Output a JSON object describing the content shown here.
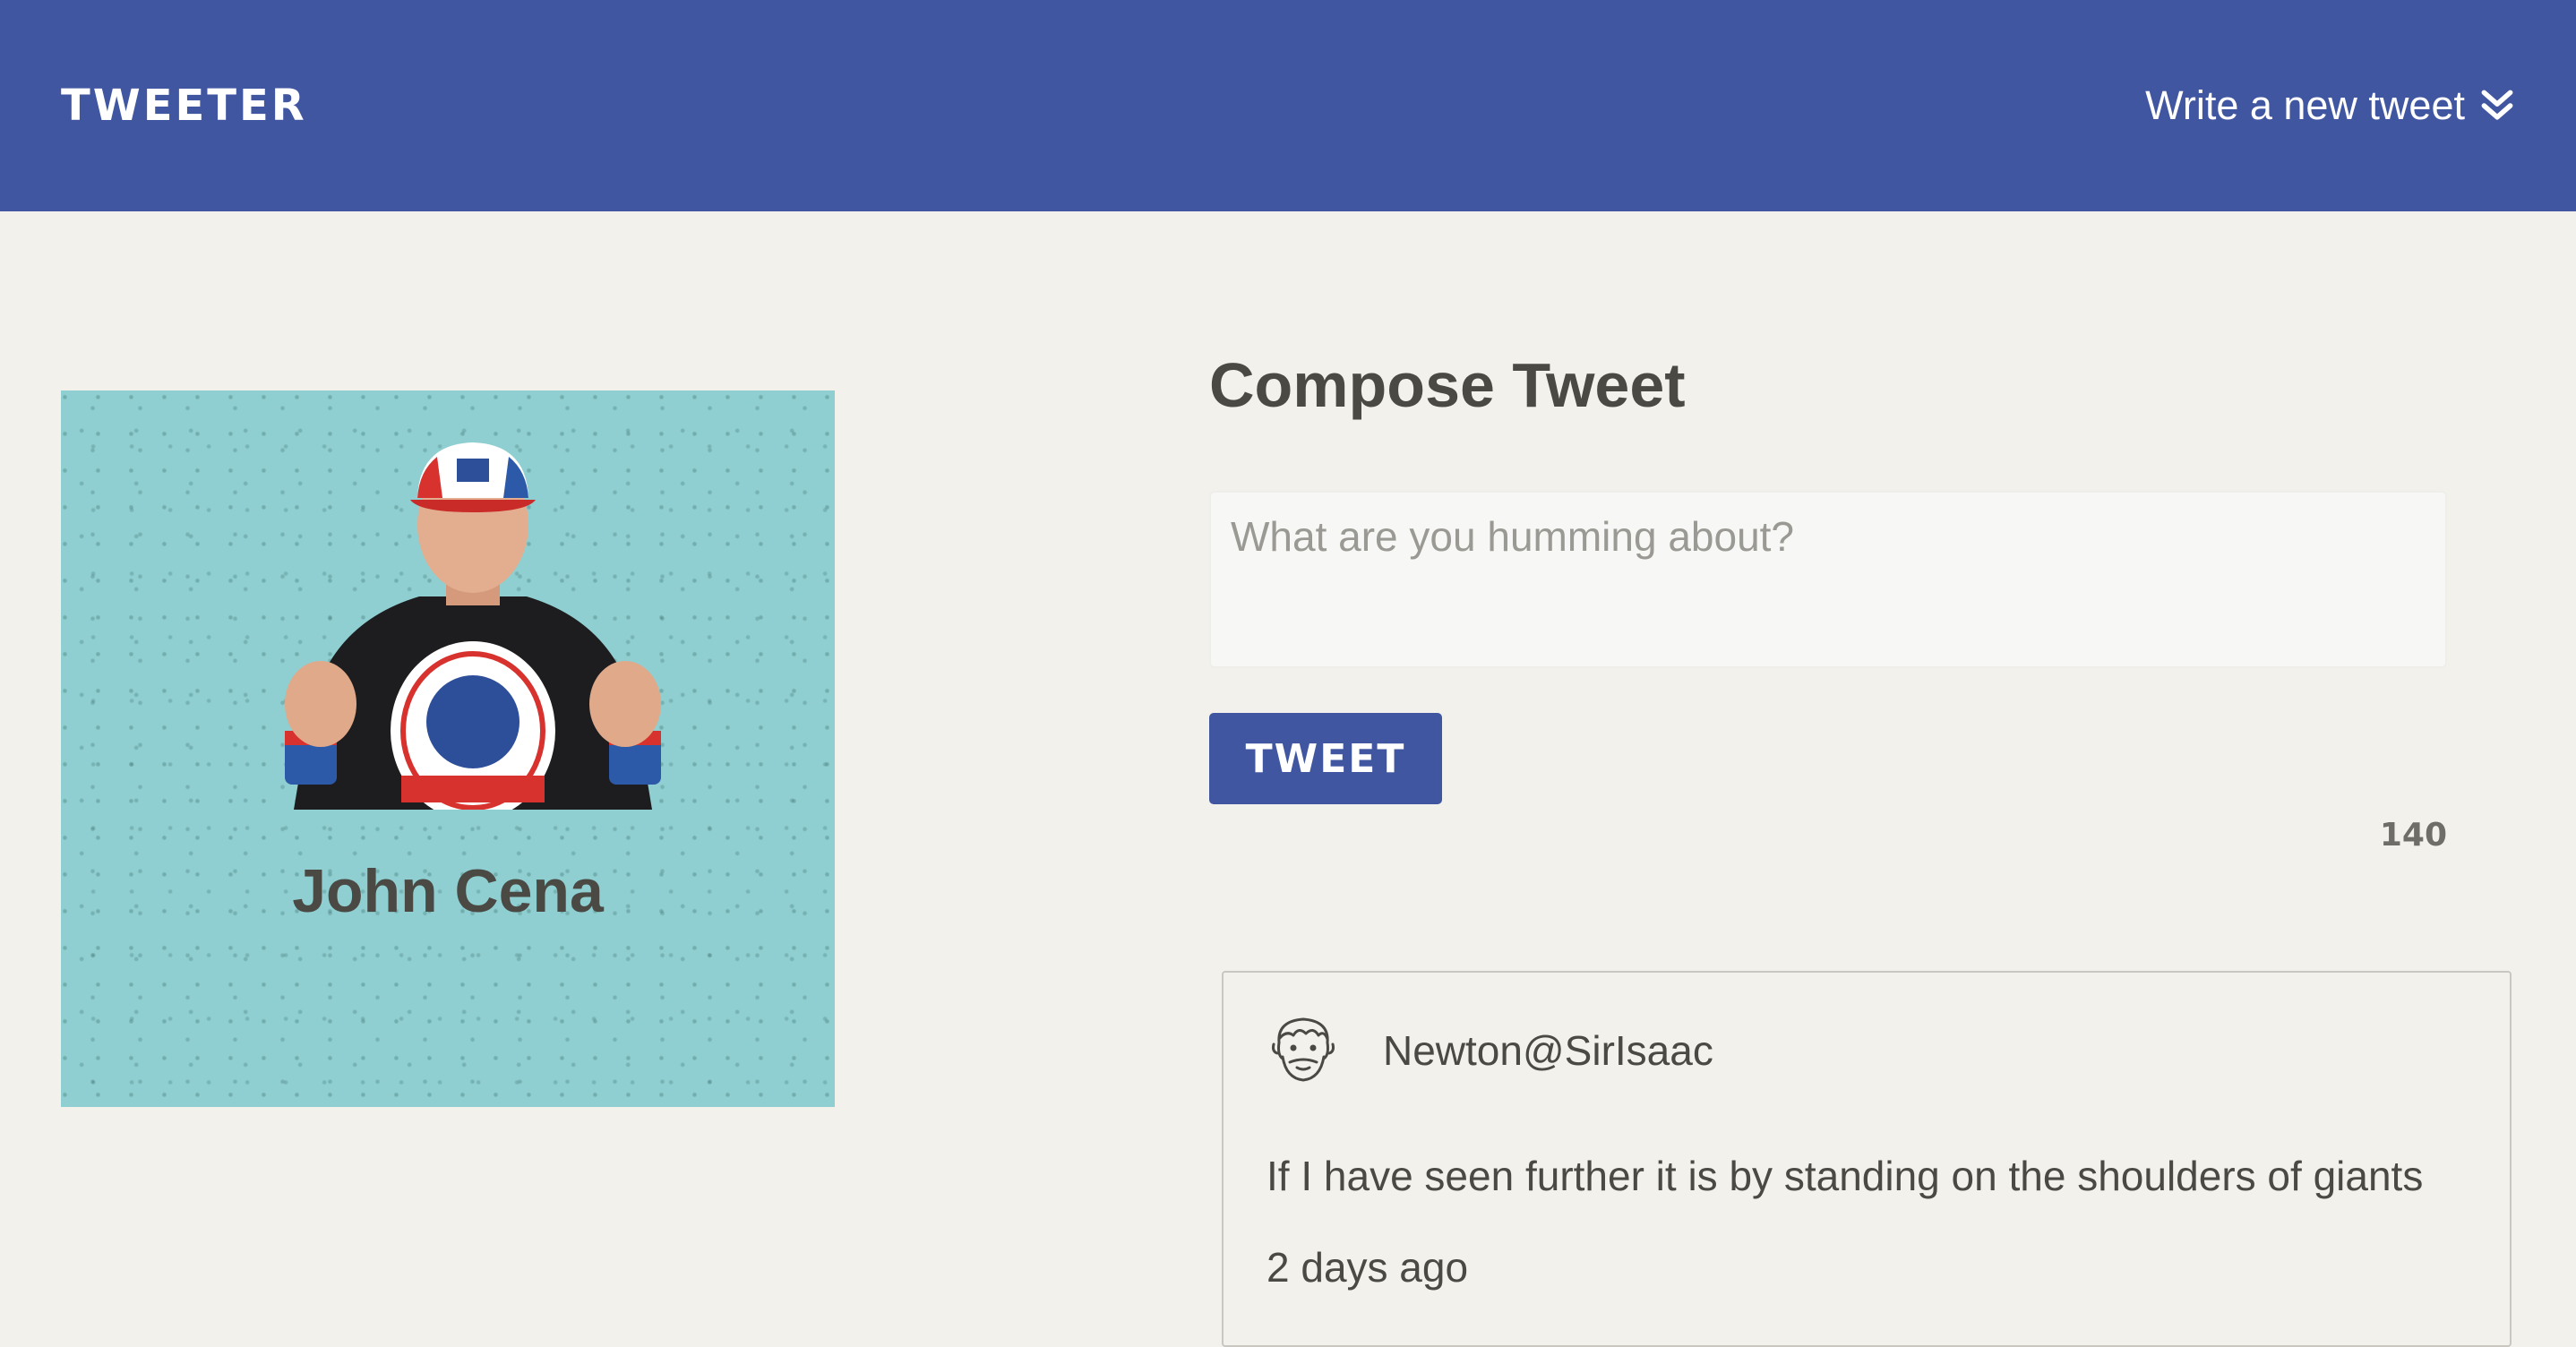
{
  "navbar": {
    "brand": "TWEETER",
    "compose_link": "Write a new tweet",
    "compose_icon": "double-chevron-down-icon",
    "background": "#4056a1"
  },
  "profile": {
    "name": "John Cena",
    "background": "#8fcfd1"
  },
  "compose": {
    "title": "Compose Tweet",
    "placeholder": "What are you humming about?",
    "value": "",
    "button_label": "TWEET",
    "counter": "140"
  },
  "tweets": [
    {
      "avatar_icon": "bearded-face-icon",
      "handle": "Newton@SirIsaac",
      "text": "If I have seen further it is by standing on the shoulders of giants",
      "time": "2 days ago"
    }
  ],
  "colors": {
    "accent": "#4056a1",
    "page_background": "#f3f1ec",
    "text": "#4a4944"
  }
}
